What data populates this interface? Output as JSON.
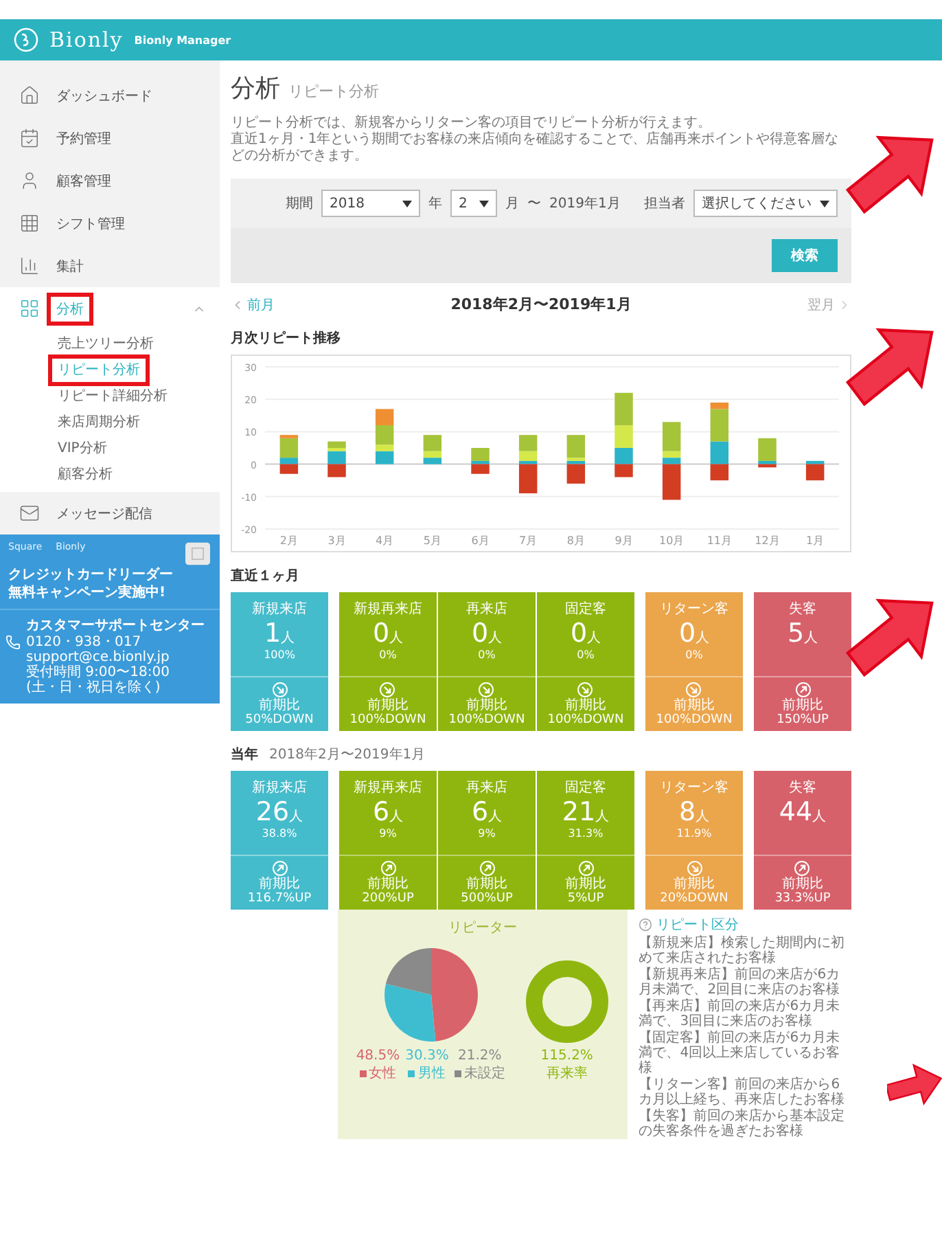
{
  "header": {
    "logo": "Bionly",
    "product": "Bionly Manager"
  },
  "sidebar": {
    "items": [
      {
        "label": "ダッシュボード",
        "selected": false,
        "expanded": false,
        "highlighted": false
      },
      {
        "label": "予約管理",
        "selected": false,
        "expanded": false,
        "highlighted": false
      },
      {
        "label": "顧客管理",
        "selected": false,
        "expanded": false,
        "highlighted": false
      },
      {
        "label": "シフト管理",
        "selected": false,
        "expanded": false,
        "highlighted": false
      },
      {
        "label": "集計",
        "selected": false,
        "expanded": false,
        "highlighted": false
      },
      {
        "label": "分析",
        "selected": true,
        "expanded": true,
        "highlighted": true,
        "children": [
          {
            "label": "売上ツリー分析",
            "selected": false,
            "highlighted": false
          },
          {
            "label": "リピート分析",
            "selected": true,
            "highlighted": true
          },
          {
            "label": "リピート詳細分析",
            "selected": false,
            "highlighted": false
          },
          {
            "label": "来店周期分析",
            "selected": false,
            "highlighted": false
          },
          {
            "label": "VIP分析",
            "selected": false,
            "highlighted": false
          },
          {
            "label": "顧客分析",
            "selected": false,
            "highlighted": false
          }
        ]
      },
      {
        "label": "メッセージ配信",
        "selected": false,
        "expanded": false,
        "highlighted": false
      }
    ]
  },
  "promo": {
    "brands": [
      "Square",
      "Bionly"
    ],
    "lines": [
      "クレジットカードリーダー",
      "無料キャンペーン実施中!"
    ]
  },
  "support": {
    "title": "カスタマーサポートセンター",
    "lines": [
      "0120・938・017",
      "support@ce.bionly.jp",
      "受付時間 9:00〜18:00",
      "(土・日・祝日を除く)"
    ]
  },
  "page": {
    "title": "分析",
    "subtitle": "リピート分析",
    "description": [
      "リピート分析では、新規客からリターン客の項目でリピート分析が行えます。",
      "直近1ヶ月・1年という期間でお客様の来店傾向を確認することで、店舗再来ポイントや得意客層などの分析ができます。"
    ]
  },
  "filter": {
    "period_label": "期間",
    "year": "2018",
    "year_unit": "年",
    "month": "2",
    "month_unit": "月",
    "tilde": "〜",
    "end": "2019年1月",
    "staff_label": "担当者",
    "staff": "選択してください",
    "search_button": "検索"
  },
  "period_nav": {
    "prev": "前月",
    "current": "2018年2月〜2019年1月",
    "next": "翌月",
    "next_disabled": true
  },
  "monthly_chart": {
    "title": "月次リピート推移",
    "chart_data": {
      "type": "bar",
      "stacked": true,
      "grid": true,
      "categories": [
        "2月",
        "3月",
        "4月",
        "5月",
        "6月",
        "7月",
        "8月",
        "9月",
        "10月",
        "11月",
        "12月",
        "1月"
      ],
      "ylim": [
        -20,
        30
      ],
      "yticks": [
        -20,
        -10,
        0,
        10,
        20,
        30
      ],
      "series": [
        {
          "color": "#2bb3c8",
          "values": [
            2,
            4,
            4,
            2,
            1,
            1,
            1,
            5,
            2,
            7,
            1,
            1
          ]
        },
        {
          "color": "#d5e84a",
          "values": [
            0,
            1,
            2,
            2,
            0,
            3,
            1,
            7,
            2,
            0,
            0,
            0
          ]
        },
        {
          "color": "#a6c43a",
          "values": [
            6,
            2,
            6,
            5,
            4,
            5,
            7,
            10,
            9,
            10,
            7,
            0
          ]
        },
        {
          "color": "#ef8f33",
          "values": [
            1,
            0,
            5,
            0,
            0,
            0,
            0,
            0,
            0,
            2,
            0,
            0
          ]
        },
        {
          "color": "#d33d22",
          "values": [
            -3,
            -4,
            0,
            0,
            -3,
            -9,
            -6,
            -4,
            -11,
            -5,
            -1,
            -5
          ]
        }
      ]
    }
  },
  "recent": {
    "title": "直近１ヶ月",
    "cards": [
      {
        "label": "新規来店",
        "count": "1",
        "unit": "人",
        "percent": "100%",
        "rising": false,
        "compare_label": "前期比",
        "change": "50%DOWN",
        "color": "#45bccb"
      },
      {
        "label": "新規再来店",
        "count": "0",
        "unit": "人",
        "percent": "0%",
        "rising": false,
        "compare_label": "前期比",
        "change": "100%DOWN",
        "color": "#8fb60f"
      },
      {
        "label": "再来店",
        "count": "0",
        "unit": "人",
        "percent": "0%",
        "rising": false,
        "compare_label": "前期比",
        "change": "100%DOWN",
        "color": "#8fb60f"
      },
      {
        "label": "固定客",
        "count": "0",
        "unit": "人",
        "percent": "0%",
        "rising": false,
        "compare_label": "前期比",
        "change": "100%DOWN",
        "color": "#8fb60f"
      },
      {
        "label": "リターン客",
        "count": "0",
        "unit": "人",
        "percent": "0%",
        "rising": false,
        "compare_label": "前期比",
        "change": "100%DOWN",
        "color": "#eba54b"
      },
      {
        "label": "失客",
        "count": "5",
        "unit": "人",
        "rising": true,
        "compare_label": "前期比",
        "change": "150%UP",
        "color": "#d6616a"
      }
    ]
  },
  "year": {
    "title": "当年",
    "range": "2018年2月〜2019年1月",
    "cards": [
      {
        "label": "新規来店",
        "count": "26",
        "unit": "人",
        "percent": "38.8%",
        "rising": true,
        "compare_label": "前期比",
        "change": "116.7%UP",
        "color": "#45bccb"
      },
      {
        "label": "新規再来店",
        "count": "6",
        "unit": "人",
        "percent": "9%",
        "rising": true,
        "compare_label": "前期比",
        "change": "200%UP",
        "color": "#8fb60f"
      },
      {
        "label": "再来店",
        "count": "6",
        "unit": "人",
        "percent": "9%",
        "rising": true,
        "compare_label": "前期比",
        "change": "500%UP",
        "color": "#8fb60f"
      },
      {
        "label": "固定客",
        "count": "21",
        "unit": "人",
        "percent": "31.3%",
        "rising": true,
        "compare_label": "前期比",
        "change": "5%UP",
        "color": "#8fb60f"
      },
      {
        "label": "リターン客",
        "count": "8",
        "unit": "人",
        "percent": "11.9%",
        "rising": false,
        "compare_label": "前期比",
        "change": "20%DOWN",
        "color": "#eba54b"
      },
      {
        "label": "失客",
        "count": "44",
        "unit": "人",
        "rising": true,
        "compare_label": "前期比",
        "change": "33.3%UP",
        "color": "#d6616a"
      }
    ]
  },
  "repeaters": {
    "title": "リピーター",
    "chart_data": {
      "type": "pie",
      "legend": "bottom",
      "categories": [
        "女性",
        "男性",
        "未設定"
      ],
      "values": [
        48.5,
        30.3,
        21.2
      ]
    },
    "legend": [
      {
        "value": "48.5%",
        "color": "#d9636b"
      },
      {
        "value": "30.3%",
        "color": "#3fbdd0"
      },
      {
        "value": "21.2%",
        "color": "#8a8a8a"
      }
    ],
    "rate": {
      "value": "115.2%",
      "label": "再来率"
    }
  },
  "definitions": {
    "title": "リピート区分",
    "items": [
      "【新規来店】検索した期間内に初めて来店されたお客様",
      "【新規再来店】前回の来店が6カ月未満で、2回目に来店のお客様",
      "【再来店】前回の来店が6カ月未満で、3回目に来店のお客様",
      "【固定客】前回の来店が6カ月未満で、4回以上来店しているお客様",
      "【リターン客】前回の来店から6カ月以上経ち、再来店したお客様",
      "【失客】前回の来店から基本設定の失客条件を過ぎたお客様"
    ]
  }
}
